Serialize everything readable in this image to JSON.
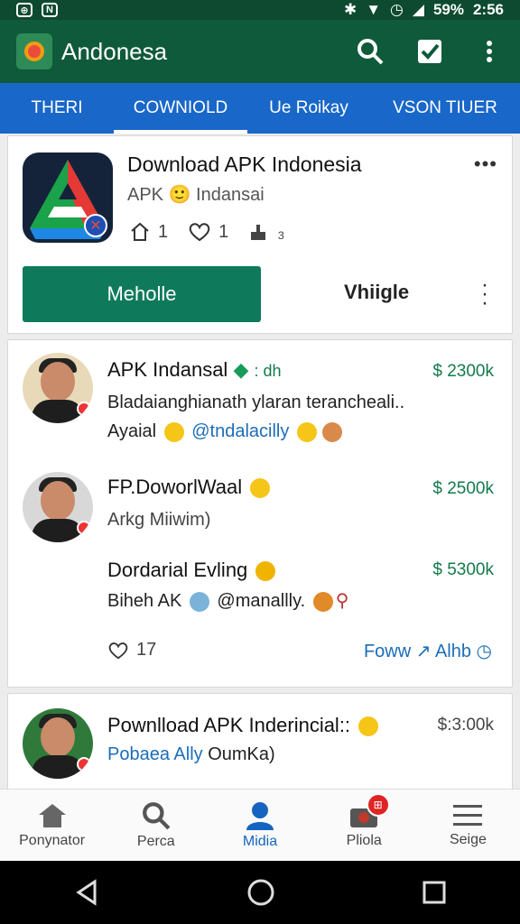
{
  "status": {
    "time": "2:56",
    "battery": "59%"
  },
  "app": {
    "title": "Andonesa"
  },
  "tabs": [
    {
      "label": "THERI"
    },
    {
      "label": "COWNIOLD"
    },
    {
      "label": "Ue Roikay"
    },
    {
      "label": "VSON TIUER"
    }
  ],
  "app_card": {
    "title": "Download APK Indonesia",
    "subtitle": "APK 🙂 Indansai",
    "more": "•••",
    "home_count": "1",
    "like_count": "1",
    "share_text": "₃",
    "primary_button": "Meholle",
    "secondary_button": "Vhiigle"
  },
  "posts": [
    {
      "name": "APK Indansal",
      "tag": ": dh",
      "price": "$ 2300k",
      "line1": "Bladaianghianath ylaran terancheali..",
      "line2_prefix": "Ayaial",
      "line2_link": "@tndalacilly"
    },
    {
      "name": "FP.DoworlWaal",
      "price": "$ 2500k",
      "line1": "Arkg Miiwim)"
    },
    {
      "name": "Dordarial Evling",
      "price": "$ 5300k",
      "line1_prefix": "Biheh AK",
      "line1_link": "@manallly."
    }
  ],
  "post_footer": {
    "likes": "17",
    "follow": "Foww",
    "follow2": "Alhb"
  },
  "card3": {
    "name": "Pownlload APK Inderincial::",
    "price": "$:3:00k",
    "link": "Pobaea Ally",
    "rest": "OumKa)"
  },
  "bottom_nav": [
    {
      "label": "Ponynator"
    },
    {
      "label": "Perca"
    },
    {
      "label": "Midia"
    },
    {
      "label": "Pliola"
    },
    {
      "label": "Seige"
    }
  ],
  "colors": {
    "appbar": "#0f5a3a",
    "tabs": "#1967c9",
    "primary": "#0f7a5b",
    "price": "#137a4c"
  }
}
